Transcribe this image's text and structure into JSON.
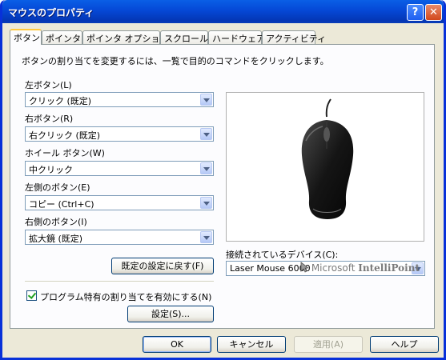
{
  "window": {
    "title": "マウスのプロパティ",
    "help_glyph": "?",
    "close_glyph": "✕"
  },
  "tabs": [
    {
      "label": "ボタン",
      "active": true
    },
    {
      "label": "ポインタ"
    },
    {
      "label": "ポインタ オプション"
    },
    {
      "label": "スクロール"
    },
    {
      "label": "ハードウェア"
    },
    {
      "label": "アクティビティ"
    }
  ],
  "buttons_page": {
    "instruction": "ボタンの割り当てを変更するには、一覧で目的のコマンドをクリックします。",
    "assignments": [
      {
        "label": "左ボタン(L)",
        "value": "クリック (既定)"
      },
      {
        "label": "右ボタン(R)",
        "value": "右クリック (既定)"
      },
      {
        "label": "ホイール ボタン(W)",
        "value": "中クリック"
      },
      {
        "label": "左側のボタン(E)",
        "value": "コピー (Ctrl+C)"
      },
      {
        "label": "右側のボタン(I)",
        "value": "拡大鏡 (既定)"
      }
    ],
    "restore_defaults_label": "既定の設定に戻す(F)",
    "program_specific_label": "プログラム特有の割り当てを有効にする(N)",
    "program_specific_checked": true,
    "settings_label": "設定(S)...",
    "device_label": "接続されているデバイス(C):",
    "device_value": "Laser Mouse 6000",
    "logo_text": "Microsoft",
    "logo_bold": "IntelliPoint"
  },
  "footer": {
    "ok": "OK",
    "cancel": "キャンセル",
    "apply": "適用(A)",
    "help": "ヘルプ"
  },
  "colors": {
    "titlebar": "#0548d6",
    "window_border": "#0831d9",
    "dialog_bg": "#ece9d8",
    "tab_highlight": "#ffc83c",
    "check": "#21a121"
  }
}
